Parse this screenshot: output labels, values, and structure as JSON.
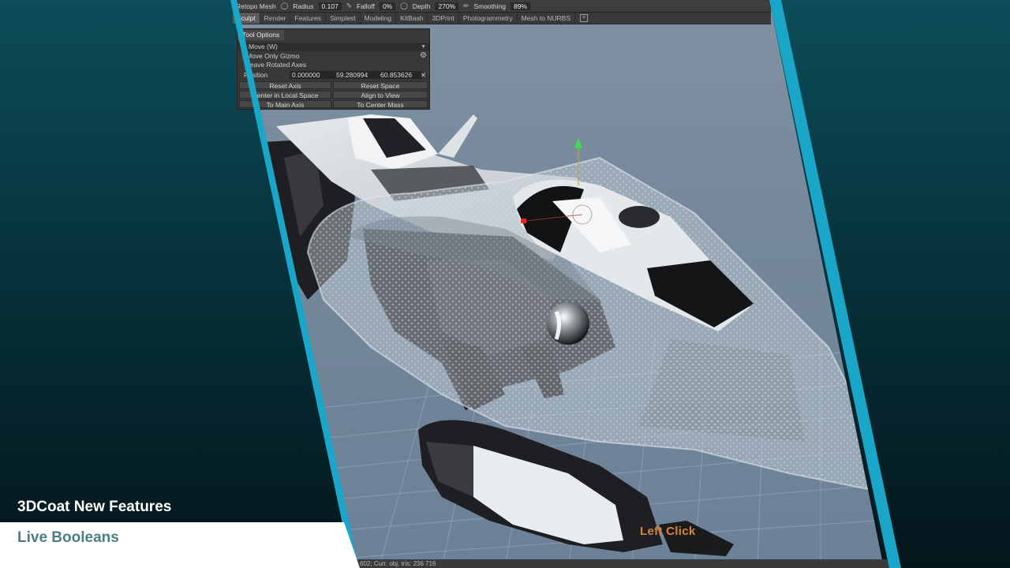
{
  "toolbar": {
    "mode": "Retopo Mesh",
    "radius_label": "Radius",
    "radius_value": "0.107",
    "falloff_label": "Falloff",
    "falloff_value": "0%",
    "depth_label": "Depth",
    "depth_value": "270%",
    "smoothing_label": "Smoothing",
    "smoothing_value": "89%"
  },
  "tabs": [
    {
      "label": "Sculpt",
      "active": true
    },
    {
      "label": "Render"
    },
    {
      "label": "Features"
    },
    {
      "label": "Simplest"
    },
    {
      "label": "Modeling"
    },
    {
      "label": "KitBash"
    },
    {
      "label": "3DPrint"
    },
    {
      "label": "Photogrammetry"
    },
    {
      "label": "Mesh  to  NURBS"
    }
  ],
  "tool_options": {
    "title": "Tool  Options",
    "mode_select": "Move  (W)",
    "move_only_gizmo": "Move  Only  Gizmo",
    "leave_rotated_axes": "Leave  Rotated  Axes",
    "position_label": "Position",
    "position": [
      "0.000000",
      "59.280994",
      "60.853626"
    ],
    "buttons": [
      {
        "label": "Reset  Axis"
      },
      {
        "label": "Reset  Space"
      },
      {
        "label": "Center  in  Local  Space"
      },
      {
        "label": "Align  to  View"
      },
      {
        "label": "To  Main  Axis"
      },
      {
        "label": "To  Center  Mass"
      }
    ]
  },
  "status": "602;  Curr.  obj.  tris:  236  716",
  "left_click": "Left Click",
  "overlay": {
    "title": "3DCoat New Features",
    "subtitle": "Live Booleans"
  },
  "colors": {
    "frame_cyan": "#1aa6c9",
    "accent_orange": "#d8843a",
    "subtitle_teal": "#4a7d86"
  }
}
